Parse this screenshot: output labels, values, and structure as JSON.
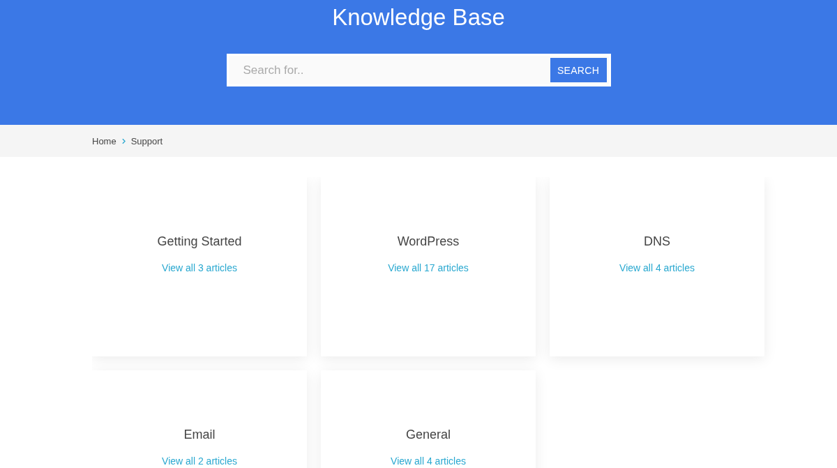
{
  "header": {
    "title": "Knowledge Base"
  },
  "search": {
    "placeholder": "Search for..",
    "button": "SEARCH"
  },
  "breadcrumb": [
    {
      "label": "Home"
    },
    {
      "label": "Support"
    }
  ],
  "categories": [
    {
      "title": "Getting Started",
      "link": "View all 3 articles"
    },
    {
      "title": "WordPress",
      "link": "View all 17 articles"
    },
    {
      "title": "DNS",
      "link": "View all 4 articles"
    },
    {
      "title": "Email",
      "link": "View all 2 articles"
    },
    {
      "title": "General",
      "link": "View all 4 articles"
    }
  ]
}
